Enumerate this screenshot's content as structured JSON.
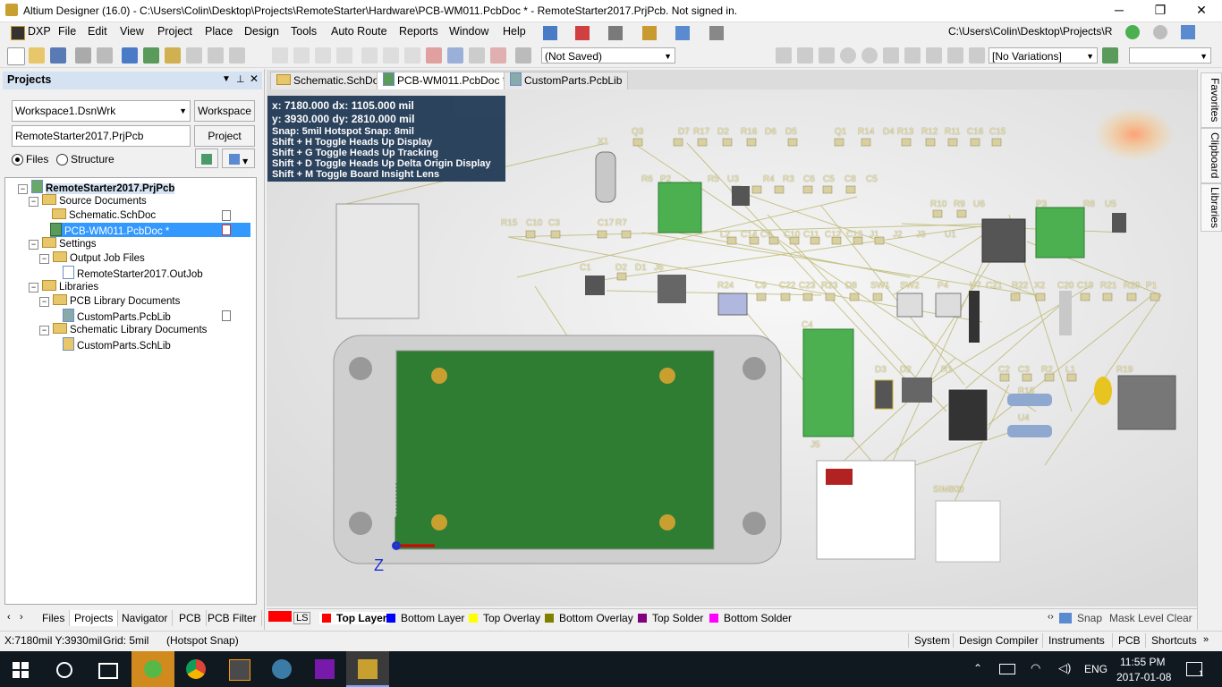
{
  "window": {
    "title": "Altium Designer (16.0) - C:\\Users\\Colin\\Desktop\\Projects\\RemoteStarter\\Hardware\\PCB-WM011.PcbDoc * - RemoteStarter2017.PrjPcb. Not signed in.",
    "minimize": "─",
    "restore": "❐",
    "close": "✕"
  },
  "menu": [
    "DXP",
    "File",
    "Edit",
    "View",
    "Project",
    "Place",
    "Design",
    "Tools",
    "Auto Route",
    "Reports",
    "Window",
    "Help"
  ],
  "path_box": "C:\\Users\\Colin\\Desktop\\Projects\\R",
  "toolbar": {
    "save_state": "(Not Saved)",
    "variations": "[No Variations]"
  },
  "projects_panel": {
    "title": "Projects",
    "workspace_value": "Workspace1.DsnWrk",
    "workspace_button": "Workspace",
    "project_value": "RemoteStarter2017.PrjPcb",
    "project_button": "Project",
    "radio_files": "Files",
    "radio_structure": "Structure",
    "tree": [
      {
        "label": "RemoteStarter2017.PrjPcb",
        "kind": "project"
      },
      {
        "label": "Source Documents",
        "kind": "folder"
      },
      {
        "label": "Schematic.SchDoc",
        "kind": "doc"
      },
      {
        "label": "PCB-WM011.PcbDoc *",
        "kind": "doc"
      },
      {
        "label": "Settings",
        "kind": "folder"
      },
      {
        "label": "Output Job Files",
        "kind": "folder"
      },
      {
        "label": "RemoteStarter2017.OutJob",
        "kind": "doc"
      },
      {
        "label": "Libraries",
        "kind": "folder"
      },
      {
        "label": "PCB Library Documents",
        "kind": "folder"
      },
      {
        "label": "CustomParts.PcbLib",
        "kind": "doc"
      },
      {
        "label": "Schematic Library Documents",
        "kind": "folder"
      },
      {
        "label": "CustomParts.SchLib",
        "kind": "doc"
      }
    ],
    "bottom_tabs": [
      "Files",
      "Projects",
      "Navigator",
      "PCB",
      "PCB Filter"
    ]
  },
  "doc_tabs": [
    "Schematic.SchDoc",
    "PCB-WM011.PcbDoc *",
    "CustomParts.PcbLib"
  ],
  "right_tabs": [
    "Favorites",
    "Clipboard",
    "Libraries"
  ],
  "hud": {
    "line1": "x:  7180.000   dx:  1105.000  mil",
    "line2": "y:  3930.000   dy:  2810.000  mil",
    "snap": "Snap: 5mil Hotspot Snap: 8mil",
    "help": [
      "Shift + H   Toggle Heads Up Display",
      "Shift + G   Toggle Heads Up Tracking",
      "Shift + D   Toggle Heads Up Delta Origin Display",
      "Shift + M   Toggle Board Insight Lens"
    ]
  },
  "designators": [
    "Q3",
    "D7",
    "R17",
    "D2",
    "R16",
    "D6",
    "D5",
    "Q1",
    "R14",
    "D4",
    "R13",
    "R12",
    "R11",
    "C16",
    "C15",
    "X1",
    "R6",
    "P2",
    "R5",
    "U3",
    "R4",
    "R3",
    "C6",
    "C5",
    "C8",
    "C5",
    "R10",
    "R9",
    "U6",
    "P3",
    "R8",
    "U5",
    "R15",
    "C10",
    "C3",
    "C17",
    "R7",
    "L2",
    "C14",
    "C9",
    "C10",
    "C11",
    "C12",
    "C13",
    "J1",
    "J2",
    "J3",
    "U1",
    "C1",
    "D2",
    "D1",
    "J6",
    "R24",
    "C9",
    "C22",
    "C23",
    "R23",
    "D8",
    "SW1",
    "SW2",
    "P4",
    "U7",
    "C21",
    "R22",
    "X2",
    "C20",
    "C19",
    "R21",
    "R20",
    "P1",
    "C4",
    "D3",
    "D2",
    "R1",
    "C2",
    "C3",
    "R2",
    "L1",
    "R19",
    "R15",
    "U4",
    "J5",
    "SIM800"
  ],
  "layers": [
    {
      "name": "LS",
      "color": "#ff0000"
    },
    {
      "name": "Top Layer",
      "color": "#ff0000"
    },
    {
      "name": "Bottom Layer",
      "color": "#0000ff"
    },
    {
      "name": "Top Overlay",
      "color": "#ffff00"
    },
    {
      "name": "Bottom Overlay",
      "color": "#808000"
    },
    {
      "name": "Top Solder",
      "color": "#800080"
    },
    {
      "name": "Bottom Solder",
      "color": "#ff00ff"
    }
  ],
  "layer_tools": [
    "Snap",
    "Mask Level",
    "Clear"
  ],
  "status": {
    "coords": "X:7180mil Y:3930mil",
    "grid": "Grid: 5mil",
    "snap": "(Hotspot Snap)",
    "panels": [
      "System",
      "Design Compiler",
      "Instruments",
      "PCB",
      "Shortcuts"
    ]
  },
  "taskbar": {
    "language": "ENG",
    "time": "11:55 PM",
    "date": "2017-01-08",
    "notifications": "1"
  }
}
